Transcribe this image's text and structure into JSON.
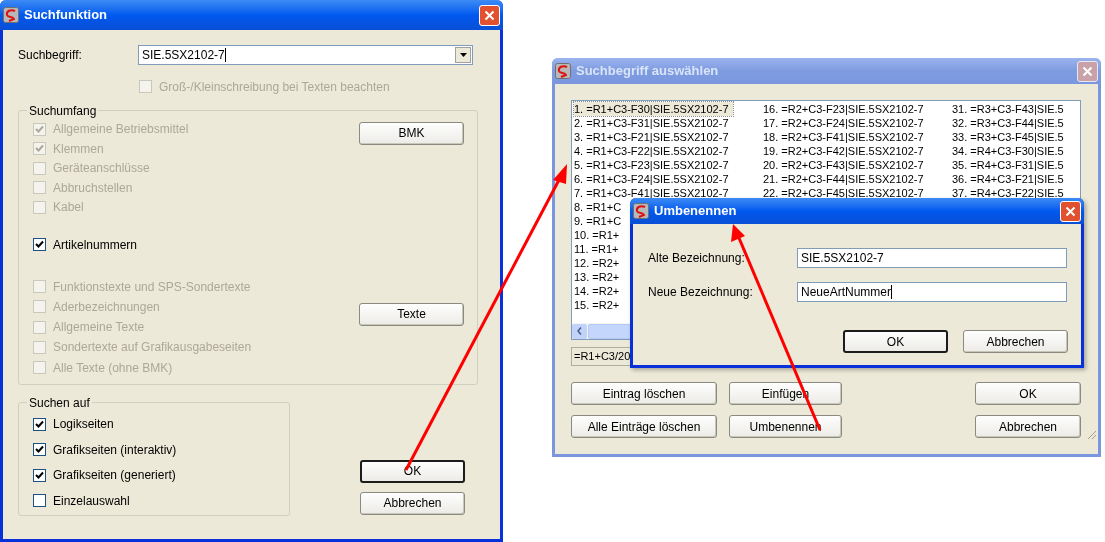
{
  "search_dialog": {
    "title": "Suchfunktion",
    "active": true,
    "search_field": {
      "label": "Suchbegriff:",
      "value": "SIE.5SX2102-7",
      "focused": true
    },
    "case_option": {
      "label": "Groß-/Kleinschreibung bei Texten beachten",
      "checked": false,
      "disabled": true
    },
    "scope": {
      "title": "Suchumfang",
      "option_groups": [
        [
          {
            "label": "Allgemeine Betriebsmittel",
            "checked": true,
            "disabled": true
          },
          {
            "label": "Klemmen",
            "checked": true,
            "disabled": true
          },
          {
            "label": "Geräteanschlüsse",
            "checked": false,
            "disabled": true
          },
          {
            "label": "Abbruchstellen",
            "checked": false,
            "disabled": true
          },
          {
            "label": "Kabel",
            "checked": false,
            "disabled": true
          }
        ],
        [
          {
            "label": "Artikelnummern",
            "checked": true,
            "disabled": false
          }
        ],
        [
          {
            "label": "Funktionstexte und SPS-Sondertexte",
            "checked": false,
            "disabled": true
          },
          {
            "label": "Aderbezeichnungen",
            "checked": false,
            "disabled": true
          },
          {
            "label": "Allgemeine Texte",
            "checked": false,
            "disabled": true
          },
          {
            "label": "Sondertexte auf Grafikausgabeseiten",
            "checked": false,
            "disabled": true
          },
          {
            "label": "Alle Texte (ohne BMK)",
            "checked": false,
            "disabled": true
          }
        ]
      ],
      "buttons": [
        "BMK",
        "Texte"
      ]
    },
    "search_on": {
      "title": "Suchen auf",
      "options": [
        {
          "label": "Logikseiten",
          "checked": true,
          "disabled": false
        },
        {
          "label": "Grafikseiten (interaktiv)",
          "checked": true,
          "disabled": false
        },
        {
          "label": "Grafikseiten (generiert)",
          "checked": true,
          "disabled": false
        },
        {
          "label": "Einzelauswahl",
          "checked": false,
          "disabled": false
        }
      ]
    },
    "buttons": [
      {
        "label": "OK",
        "default": true
      },
      {
        "label": "Abbrechen",
        "default": false
      }
    ]
  },
  "select_dialog": {
    "title": "Suchbegriff auswählen",
    "active": false,
    "columns": [
      [
        {
          "text": "1. =R1+C3-F30|SIE.5SX2102-7",
          "selected": true
        },
        {
          "text": "2. =R1+C3-F31|SIE.5SX2102-7",
          "selected": false
        },
        {
          "text": "3. =R1+C3-F21|SIE.5SX2102-7",
          "selected": false
        },
        {
          "text": "4. =R1+C3-F22|SIE.5SX2102-7",
          "selected": false
        },
        {
          "text": "5. =R1+C3-F23|SIE.5SX2102-7",
          "selected": false
        },
        {
          "text": "6. =R1+C3-F24|SIE.5SX2102-7",
          "selected": false
        },
        {
          "text": "7. =R1+C3-F41|SIE.5SX2102-7",
          "selected": false
        },
        {
          "text": "8. =R1+C",
          "selected": false
        },
        {
          "text": "9. =R1+C",
          "selected": false
        },
        {
          "text": "10. =R1+",
          "selected": false
        },
        {
          "text": "11. =R1+",
          "selected": false
        },
        {
          "text": "12. =R2+",
          "selected": false
        },
        {
          "text": "13. =R2+",
          "selected": false
        },
        {
          "text": "14. =R2+",
          "selected": false
        },
        {
          "text": "15. =R2+",
          "selected": false
        }
      ],
      [
        {
          "text": "16. =R2+C3-F23|SIE.5SX2102-7",
          "selected": false
        },
        {
          "text": "17. =R2+C3-F24|SIE.5SX2102-7",
          "selected": false
        },
        {
          "text": "18. =R2+C3-F41|SIE.5SX2102-7",
          "selected": false
        },
        {
          "text": "19. =R2+C3-F42|SIE.5SX2102-7",
          "selected": false
        },
        {
          "text": "20. =R2+C3-F43|SIE.5SX2102-7",
          "selected": false
        },
        {
          "text": "21. =R2+C3-F44|SIE.5SX2102-7",
          "selected": false
        },
        {
          "text": "22. =R2+C3-F45|SIE.5SX2102-7",
          "selected": false
        }
      ],
      [
        {
          "text": "31. =R3+C3-F43|SIE.5",
          "selected": false
        },
        {
          "text": "32. =R3+C3-F44|SIE.5",
          "selected": false
        },
        {
          "text": "33. =R3+C3-F45|SIE.5",
          "selected": false
        },
        {
          "text": "34. =R4+C3-F30|SIE.5",
          "selected": false
        },
        {
          "text": "35. =R4+C3-F31|SIE.5",
          "selected": false
        },
        {
          "text": "36. =R4+C3-F21|SIE.5",
          "selected": false
        },
        {
          "text": "37. =R4+C3-F22|SIE.5",
          "selected": false
        }
      ]
    ],
    "status_field": "=R1+C3/20",
    "button_rows": [
      [
        {
          "label": "Eintrag löschen",
          "default": false
        },
        {
          "label": "Einfügen",
          "default": false
        },
        {
          "label": "OK",
          "default": false
        }
      ],
      [
        {
          "label": "Alle Einträge löschen",
          "default": false
        },
        {
          "label": "Umbenennen",
          "default": false
        },
        {
          "label": "Abbrechen",
          "default": false
        }
      ]
    ]
  },
  "rename_dialog": {
    "title": "Umbenennen",
    "active": true,
    "fields": [
      {
        "label": "Alte Bezeichnung:",
        "value": "SIE.5SX2102-7",
        "focused": false
      },
      {
        "label": "Neue Bezeichnung:",
        "value": "NeueArtNummer",
        "focused": true
      }
    ],
    "buttons": [
      {
        "label": "OK",
        "default": true
      },
      {
        "label": "Abbrechen",
        "default": false
      }
    ]
  }
}
